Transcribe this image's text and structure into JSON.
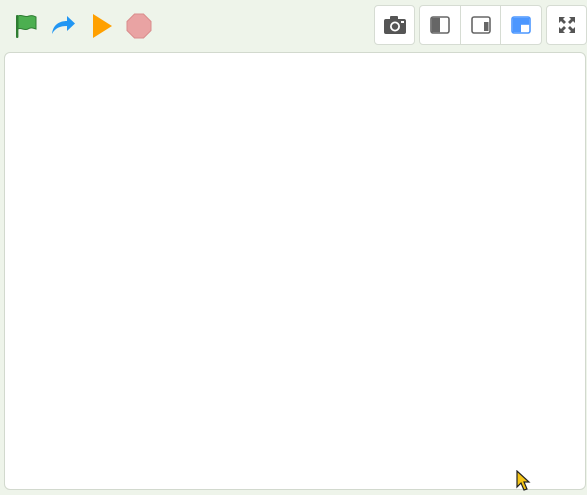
{
  "toolbar": {
    "left": [
      {
        "name": "green-flag-button",
        "icon": "green-flag-icon",
        "color": "#4caf50"
      },
      {
        "name": "redo-button",
        "icon": "redo-arrow-icon",
        "color": "#2196f3"
      },
      {
        "name": "play-button",
        "icon": "play-triangle-icon",
        "color": "#ffa000"
      },
      {
        "name": "stop-button",
        "icon": "stop-octagon-icon",
        "color": "#e9a3a3"
      }
    ],
    "right": {
      "screenshot": {
        "icon": "camera-icon"
      },
      "layout_modes": [
        {
          "icon": "layout-left-half-icon",
          "selected": false
        },
        {
          "icon": "layout-right-narrow-icon",
          "selected": false
        },
        {
          "icon": "layout-small-stage-icon",
          "selected": true
        }
      ],
      "fullscreen": {
        "icon": "fullscreen-expand-icon"
      }
    },
    "accent_color": "#4c97ff"
  },
  "stage": {
    "background": "#ffffff"
  }
}
